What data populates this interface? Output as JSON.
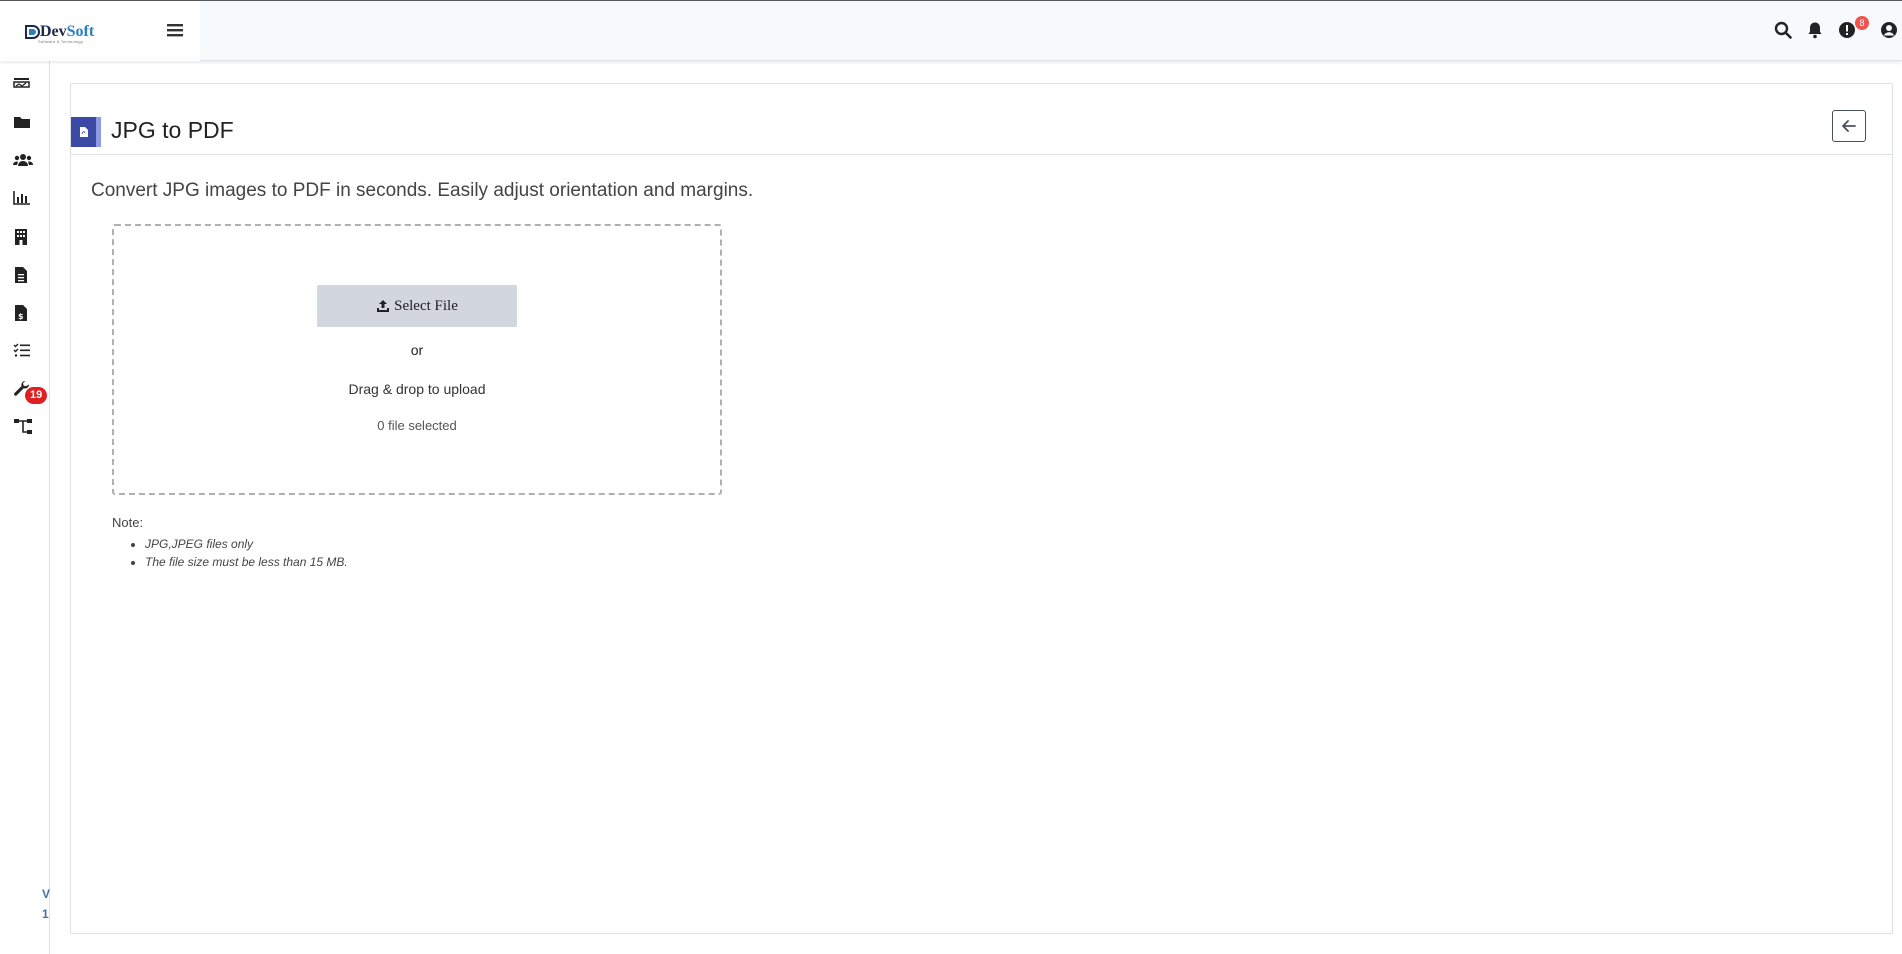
{
  "brand": {
    "name_part1": "Dev",
    "name_part2": "Soft",
    "tagline": "Software & Technology"
  },
  "header": {
    "icons": [
      "search-icon",
      "bell-icon",
      "alert-icon",
      "user-icon"
    ],
    "alert_count": "8"
  },
  "sidebar": {
    "items": [
      "dashboard-icon",
      "folder-icon",
      "users-icon",
      "chart-icon",
      "building-icon",
      "file-icon",
      "invoice-icon",
      "tasks-icon",
      "wrench-icon",
      "sitemap-icon"
    ],
    "tasks_badge": "19",
    "version_line1": "V",
    "version_line2": "1"
  },
  "page": {
    "title": "JPG to PDF",
    "description": "Convert JPG images to PDF in seconds. Easily adjust orientation and margins.",
    "upload": {
      "select_label": "Select File",
      "or_label": "or",
      "drag_label": "Drag & drop to upload",
      "file_count": "0 file selected"
    },
    "note_label": "Note:",
    "notes": [
      "JPG,JPEG files only",
      "The file size must be less than 15 MB."
    ]
  },
  "colors": {
    "accent": "#3b4aa5",
    "badge": "#e02020",
    "button_bg": "#d2d6de"
  }
}
